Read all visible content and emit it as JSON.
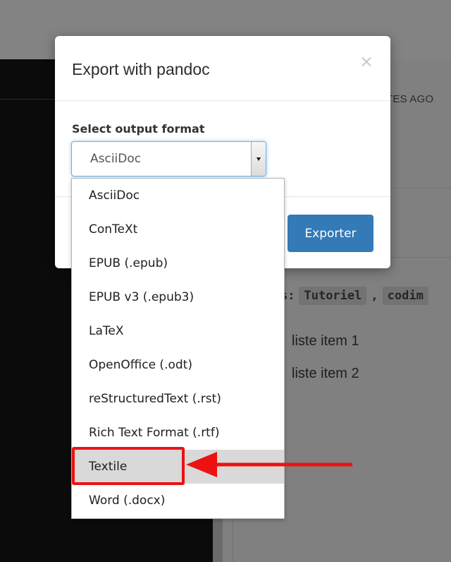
{
  "background": {
    "timestamp_fragment": "TES AGO",
    "tags": {
      "prefix": "s:",
      "items": [
        "Tutoriel",
        "codim"
      ],
      "separator": ","
    },
    "list_items": [
      "liste item 1",
      "liste item 2"
    ]
  },
  "modal": {
    "title": "Export with pandoc",
    "close_symbol": "×",
    "select_label": "Select output format",
    "selected_value": "AsciiDoc",
    "export_button_label": "Exporter",
    "options": [
      "AsciiDoc",
      "ConTeXt",
      "EPUB (.epub)",
      "EPUB v3 (.epub3)",
      "LaTeX",
      "OpenOffice (.odt)",
      "reStructuredText (.rst)",
      "Rich Text Format (.rtf)",
      "Textile",
      "Word (.docx)"
    ],
    "hovered_option": "Textile"
  },
  "colors": {
    "primary_button": "#337ab7",
    "annotation_red": "#ec1212",
    "focus_border": "#66afe9"
  },
  "icons": {
    "close": "close-icon",
    "select_arrow": "chevron-down-icon",
    "annotation_arrow": "arrow-left-icon"
  }
}
